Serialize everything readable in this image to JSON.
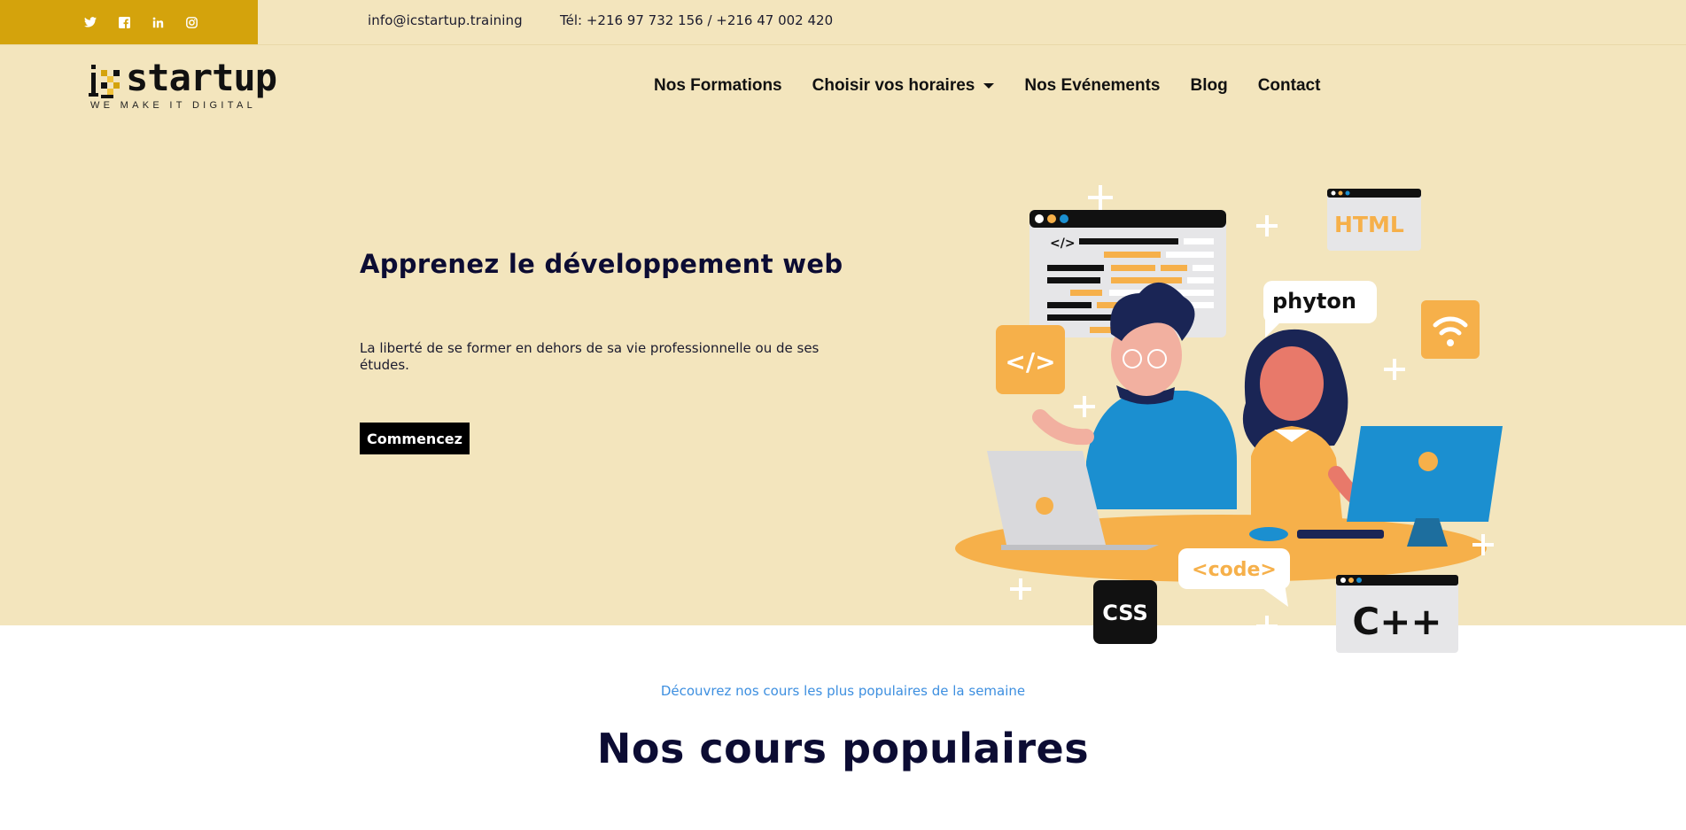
{
  "topbar": {
    "social_icons": [
      "twitter-icon",
      "facebook-icon",
      "linkedin-icon",
      "instagram-icon"
    ],
    "email": "info@icstartup.training",
    "phone": "Tél: +216 97 732 156 / +216 47 002 420",
    "accent_color": "#d4a30c",
    "bg_color": "#f3e5bd"
  },
  "brand": {
    "wordmark": "startup",
    "logo_prefix": "ic",
    "tagline": "WE MAKE IT DIGITAL"
  },
  "nav": {
    "items": [
      {
        "label": "Nos Formations"
      },
      {
        "label": "Choisir vos horaires"
      },
      {
        "label": "Nos Evénements"
      },
      {
        "label": "Blog"
      },
      {
        "label": "Contact"
      }
    ]
  },
  "hero": {
    "title": "Apprenez le développement web",
    "subtitle": "La liberté de se former en dehors de sa vie professionnelle ou de ses études.",
    "cta_label": "Commencez"
  },
  "illustration": {
    "html_label": "HTML",
    "python_label": "phyton",
    "code_tag": "</>",
    "code_bubble": "<code>",
    "css_label": "CSS",
    "cpp_label": "C++",
    "code_window_tag": "</>"
  },
  "popular": {
    "kicker": "Découvrez nos cours les plus populaires de la semaine",
    "title": "Nos cours populaires"
  }
}
